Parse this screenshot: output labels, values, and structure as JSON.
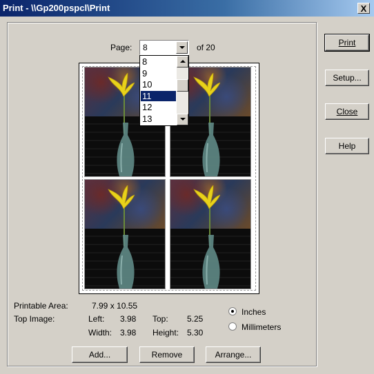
{
  "window": {
    "title": "Print - \\\\Gp200pspcl\\Print",
    "close_label": "X"
  },
  "page_selector": {
    "label": "Page:",
    "value": "8",
    "of_text": "of 20",
    "options": [
      "8",
      "9",
      "10",
      "11",
      "12",
      "13"
    ],
    "highlighted": "11"
  },
  "preview": {
    "tiles": [
      "lily-vase",
      "lily-vase",
      "lily-vase",
      "lily-vase"
    ]
  },
  "info": {
    "printable_area_label": "Printable Area:",
    "printable_area_value": "7.99 x 10.55",
    "top_image_label": "Top Image:",
    "left_label": "Left:",
    "left_value": "3.98",
    "top_label": "Top:",
    "top_value": "5.25",
    "width_label": "Width:",
    "width_value": "3.98",
    "height_label": "Height:",
    "height_value": "5.30"
  },
  "units": {
    "inches": "Inches",
    "millimeters": "Millimeters",
    "selected": "Inches"
  },
  "bottom_buttons": {
    "add": "Add...",
    "remove": "Remove",
    "arrange": "Arrange..."
  },
  "side_buttons": {
    "print": "Print",
    "setup": "Setup...",
    "close": "Close",
    "help": "Help"
  },
  "colors": {
    "titlebar": "#0a246a",
    "selection": "#0a246a",
    "dialog": "#d4d0c8"
  }
}
